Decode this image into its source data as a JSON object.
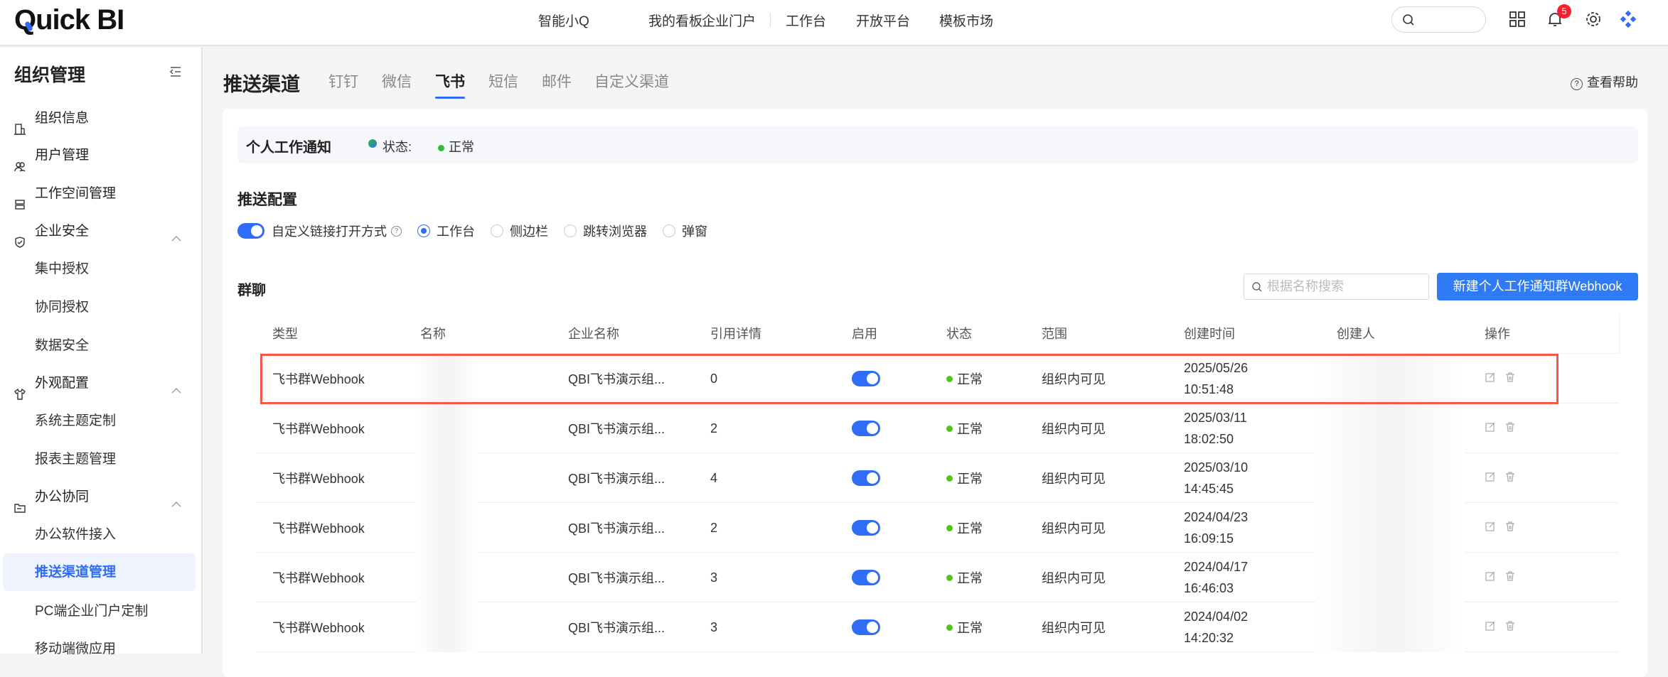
{
  "header": {
    "logo": "Quick BI",
    "nav": [
      "智能小Q",
      "我的看板",
      "企业门户",
      "工作台",
      "开放平台",
      "模板市场"
    ],
    "badge": "5"
  },
  "sidebar": {
    "title": "组织管理",
    "items": [
      {
        "label": "组织信息",
        "icon": "building-icon"
      },
      {
        "label": "用户管理",
        "icon": "users-icon"
      },
      {
        "label": "工作空间管理",
        "icon": "workspace-icon"
      },
      {
        "label": "企业安全",
        "icon": "shield-icon",
        "expanded": true
      },
      {
        "label": "集中授权",
        "sub": true
      },
      {
        "label": "协同授权",
        "sub": true
      },
      {
        "label": "数据安全",
        "sub": true
      },
      {
        "label": "外观配置",
        "icon": "shirt-icon",
        "expanded": true
      },
      {
        "label": "系统主题定制",
        "sub": true
      },
      {
        "label": "报表主题管理",
        "sub": true
      },
      {
        "label": "办公协同",
        "icon": "folder-icon",
        "expanded": true
      },
      {
        "label": "办公软件接入",
        "sub": true
      },
      {
        "label": "推送渠道管理",
        "sub": true,
        "active": true
      },
      {
        "label": "PC端企业门户定制",
        "sub": true
      },
      {
        "label": "移动端微应用",
        "sub": true
      }
    ]
  },
  "main": {
    "title": "推送渠道",
    "tabs": [
      "钉钉",
      "微信",
      "飞书",
      "短信",
      "邮件",
      "自定义渠道"
    ],
    "active_tab": "飞书",
    "help": "查看帮助",
    "notice": {
      "title": "个人工作通知",
      "status_label": "状态:",
      "status": "正常"
    },
    "config": {
      "title": "推送配置",
      "toggle_label": "自定义链接打开方式",
      "options": [
        "工作台",
        "侧边栏",
        "跳转浏览器",
        "弹窗"
      ],
      "selected": "工作台"
    },
    "group": {
      "title": "群聊",
      "search_placeholder": "根据名称搜索",
      "new_button": "新建个人工作通知群Webhook"
    },
    "table": {
      "columns": [
        "类型",
        "名称",
        "企业名称",
        "引用详情",
        "启用",
        "状态",
        "范围",
        "创建时间",
        "创建人",
        "操作"
      ],
      "rows": [
        {
          "type": "飞书群Webhook",
          "company": "QBI飞书演示组...",
          "refs": "0",
          "status": "正常",
          "scope": "组织内可见",
          "date": "2025/05/26",
          "time": "10:51:48"
        },
        {
          "type": "飞书群Webhook",
          "company": "QBI飞书演示组...",
          "refs": "2",
          "status": "正常",
          "scope": "组织内可见",
          "date": "2025/03/11",
          "time": "18:02:50"
        },
        {
          "type": "飞书群Webhook",
          "company": "QBI飞书演示组...",
          "refs": "4",
          "status": "正常",
          "scope": "组织内可见",
          "date": "2025/03/10",
          "time": "14:45:45"
        },
        {
          "type": "飞书群Webhook",
          "company": "QBI飞书演示组...",
          "refs": "2",
          "status": "正常",
          "scope": "组织内可见",
          "date": "2024/04/23",
          "time": "16:09:15"
        },
        {
          "type": "飞书群Webhook",
          "company": "QBI飞书演示组...",
          "refs": "3",
          "status": "正常",
          "scope": "组织内可见",
          "date": "2024/04/17",
          "time": "16:46:03"
        },
        {
          "type": "飞书群Webhook",
          "company": "QBI飞书演示组...",
          "refs": "3",
          "status": "正常",
          "scope": "组织内可见",
          "date": "2024/04/02",
          "time": "14:20:32"
        }
      ]
    }
  },
  "colors": {
    "accent": "#2f6df6",
    "highlight": "#f5574b",
    "ok": "#2ebd3a"
  }
}
